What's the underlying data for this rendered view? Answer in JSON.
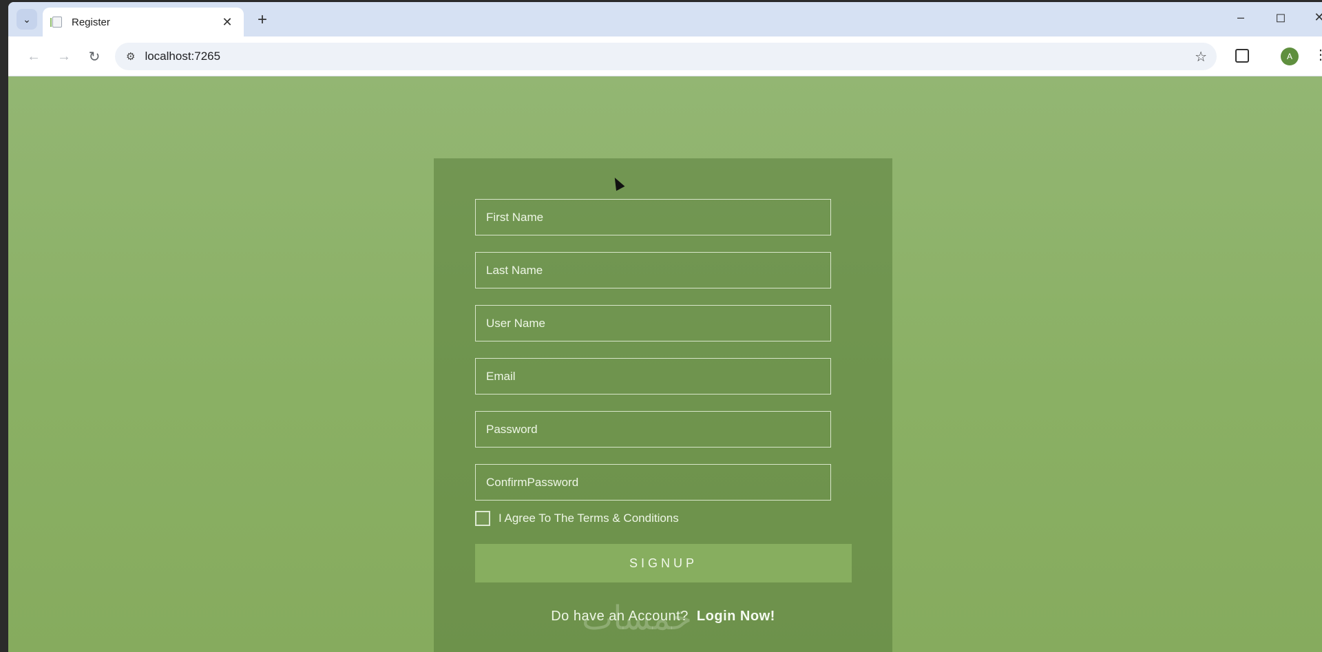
{
  "browser": {
    "tab_title": "Register",
    "url": "localhost:7265",
    "avatar_letter": "A",
    "icons": {
      "tab_search": "chevron-down-icon",
      "new_tab": "plus-icon",
      "back": "arrow-left-icon",
      "forward": "arrow-right-icon",
      "reload": "reload-icon",
      "site_info": "tune-icon",
      "bookmark": "star-icon",
      "extensions": "puzzle-icon",
      "menu": "vertical-dots-icon"
    }
  },
  "form": {
    "fields": [
      {
        "name": "first-name-input",
        "placeholder": "First Name"
      },
      {
        "name": "last-name-input",
        "placeholder": "Last Name"
      },
      {
        "name": "user-name-input",
        "placeholder": "User Name"
      },
      {
        "name": "email-input",
        "placeholder": "Email"
      },
      {
        "name": "password-input",
        "placeholder": "Password"
      },
      {
        "name": "confirm-password-input",
        "placeholder": "ConfirmPassword"
      }
    ],
    "terms_label": "I Agree To The Terms & Conditions",
    "terms_checked": false,
    "signup_label": "SIGNUP",
    "login_prompt": "Do have an Account?",
    "login_link": "Login Now!"
  },
  "colors": {
    "page_background": "#8ab064",
    "card_background": "#6c8f4c",
    "button_background": "#87ae5f",
    "text": "#eef6e6"
  },
  "watermark": "خمسات"
}
